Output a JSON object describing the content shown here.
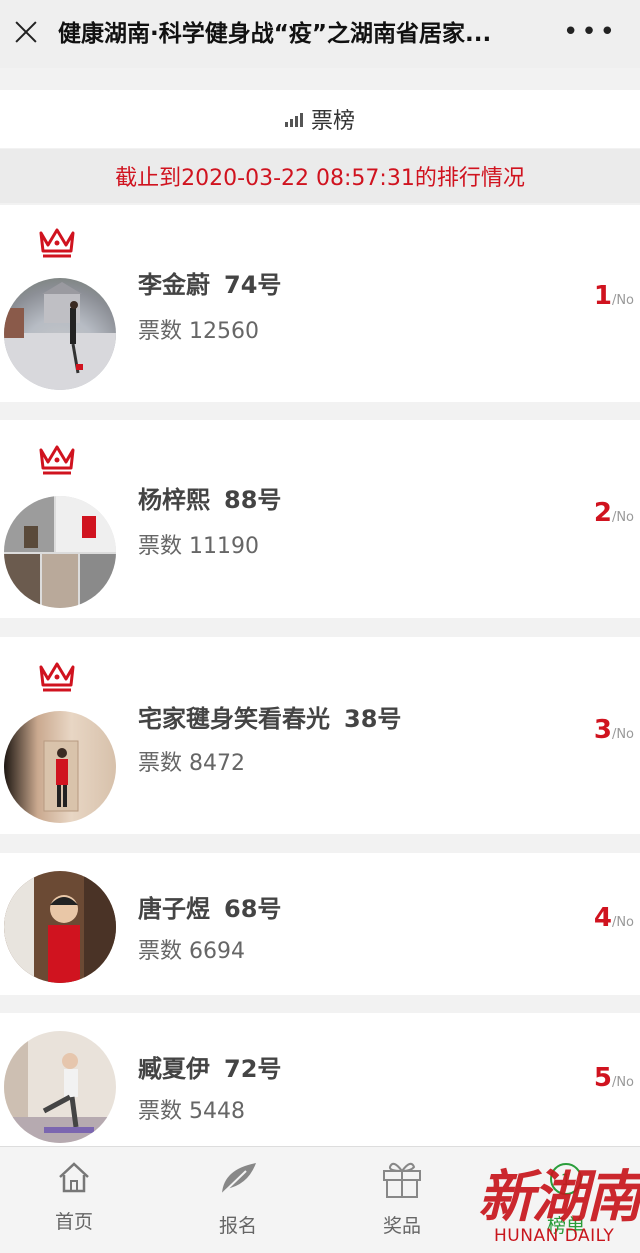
{
  "header": {
    "title": "健康湖南·科学健身战“疫”之湖南省居家...",
    "close_icon": "close-icon",
    "more_icon": "more-icon"
  },
  "tab": {
    "label": "票榜",
    "icon": "bar-chart-icon"
  },
  "cutoff_text": "截止到2020-03-22 08:57:31的排行情况",
  "entries": [
    {
      "name": "李金蔚",
      "number": "74号",
      "votes_label": "票数",
      "votes": "12560",
      "rank": "1",
      "rank_suffix": "/No",
      "crown": true
    },
    {
      "name": "杨梓熙",
      "number": "88号",
      "votes_label": "票数",
      "votes": "11190",
      "rank": "2",
      "rank_suffix": "/No",
      "crown": true
    },
    {
      "name": "宅家毽身笑看春光",
      "number": "38号",
      "votes_label": "票数",
      "votes": "8472",
      "rank": "3",
      "rank_suffix": "/No",
      "crown": true
    },
    {
      "name": "唐子煜",
      "number": "68号",
      "votes_label": "票数",
      "votes": "6694",
      "rank": "4",
      "rank_suffix": "/No",
      "crown": false
    },
    {
      "name": "臧夏伊",
      "number": "72号",
      "votes_label": "票数",
      "votes": "5448",
      "rank": "5",
      "rank_suffix": "/No",
      "crown": false
    }
  ],
  "nav": [
    {
      "label": "首页",
      "icon": "home-icon"
    },
    {
      "label": "报名",
      "icon": "feather-icon"
    },
    {
      "label": "奖品",
      "icon": "gift-icon"
    },
    {
      "label": "榜单",
      "icon": "ranking-icon"
    }
  ],
  "watermark": {
    "cn": "新湖南",
    "en": "HUNAN DAILY"
  },
  "colors": {
    "accent_red": "#d0131f",
    "active_green": "#2a9d3a"
  }
}
